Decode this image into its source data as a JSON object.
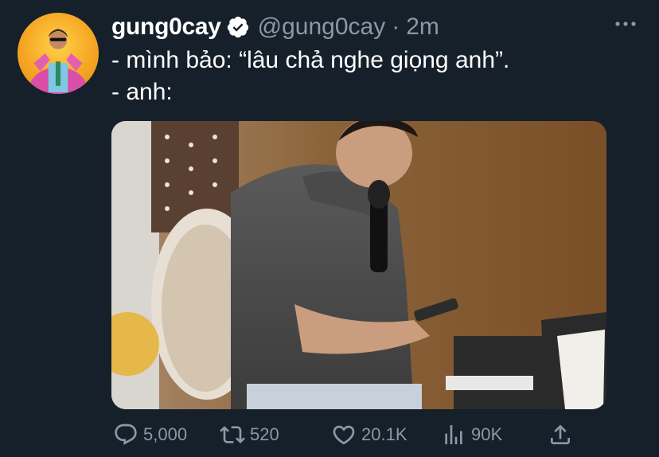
{
  "tweet": {
    "display_name": "gung0cay",
    "handle": "@gung0cay",
    "separator": "·",
    "time": "2m",
    "text_lines": [
      "- mình bảo: “lâu chả nghe giọng anh”.",
      "- anh:"
    ],
    "verified": true,
    "media_description_icon": "photo"
  },
  "actions": {
    "reply_count": "5,000",
    "retweet_count": "520",
    "like_count": "20.1K",
    "views_count": "90K"
  },
  "colors": {
    "background": "#15202b",
    "text": "#ffffff",
    "muted": "#8b98a5",
    "verified_badge": "#ffffff"
  }
}
